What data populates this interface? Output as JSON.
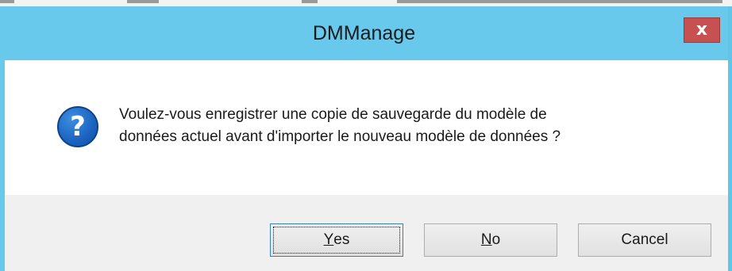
{
  "dialog": {
    "title": "DMManage",
    "close_glyph": "x",
    "icon": "question-icon",
    "icon_glyph": "?",
    "message_lines": [
      "Voulez-vous enregistrer une copie de sauvegarde du modèle de",
      "données actuel avant d'importer le nouveau modèle de données ?"
    ],
    "buttons": {
      "yes": {
        "mnemonic": "Y",
        "rest": "es"
      },
      "no": {
        "mnemonic": "N",
        "rest": "o"
      },
      "cancel": "Cancel"
    }
  },
  "colors": {
    "titlebar": "#69c9ec",
    "close_button": "#c75050",
    "footer": "#f0f0f0",
    "icon": "#1b63c1"
  }
}
